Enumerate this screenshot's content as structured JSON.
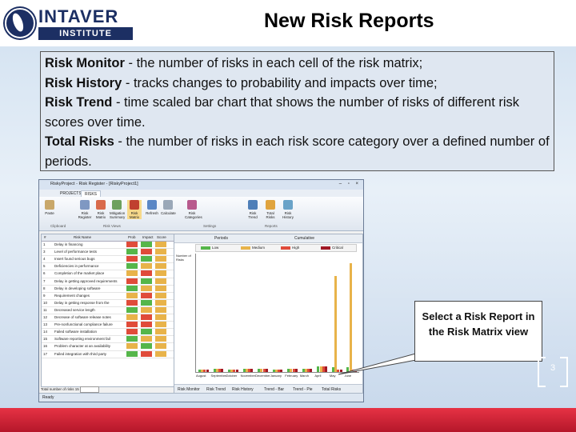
{
  "header": {
    "logo_top": "INTAVER",
    "logo_bottom": "INSTITUTE",
    "title": "New Risk Reports"
  },
  "textbox": {
    "items": [
      {
        "term": "Risk Monitor",
        "desc": " - the number of risks in each cell of the risk matrix;"
      },
      {
        "term": "Risk History",
        "desc": " - tracks changes to probability and impacts over time;"
      },
      {
        "term": "Risk Trend",
        "desc": " - time scaled bar chart that shows the  number of risks of different risk scores over time."
      },
      {
        "term": "Total Risks",
        "desc": " - the number of risks in each risk score category over a defined number of periods."
      }
    ]
  },
  "callout": {
    "text": "Select a Risk Report in the Risk Matrix view"
  },
  "page_number": "3",
  "colors": {
    "bottom_bar": "#d2263a",
    "logo_navy": "#1c2f63",
    "risk_low": "#55b64a",
    "risk_medium": "#e8b34a",
    "risk_high": "#e04b3a"
  },
  "app": {
    "window_title": "RiskyProject - Risk Register - [RiskyProject1]",
    "tabs": [
      "PROJECTS",
      "RISKS"
    ],
    "ribbon": {
      "buttons": [
        "Paste",
        "Risk Register",
        "Risk Matrix",
        "Mitigation Summary",
        "Risk Matrix",
        "Refresh",
        "Calculate",
        "Risk Categories",
        "Risk Trend",
        "Total Risks",
        "Risk History"
      ],
      "groups": [
        "Clipboard",
        "Risk Views",
        "Settings",
        "Reports"
      ]
    },
    "grid": {
      "headers": [
        "#",
        "Risk Name",
        "Prob",
        "Impact",
        "Score"
      ],
      "rows": [
        {
          "num": "1",
          "name": "Delay in financing"
        },
        {
          "num": "3",
          "name": "Level of performance tests"
        },
        {
          "num": "4",
          "name": "Insert found serious bugs"
        },
        {
          "num": "5",
          "name": "Deficiencies in performance"
        },
        {
          "num": "6",
          "name": "Completion of the market place"
        },
        {
          "num": "7",
          "name": "Delay in getting approved requirements"
        },
        {
          "num": "8",
          "name": "Delay in developing software"
        },
        {
          "num": "9",
          "name": "Requirement changes"
        },
        {
          "num": "10",
          "name": "Delay in getting response from the"
        },
        {
          "num": "11",
          "name": "Decreased service length"
        },
        {
          "num": "12",
          "name": "Decrease of software release notes"
        },
        {
          "num": "13",
          "name": "Pre-nonfunctional compliance failure"
        },
        {
          "num": "14",
          "name": "Failed software installation"
        },
        {
          "num": "15",
          "name": "Software reporting environment fail"
        },
        {
          "num": "16",
          "name": "Problem character at an availability"
        },
        {
          "num": "17",
          "name": "Failed integration with third party"
        }
      ],
      "footer": "Total number of risks 15"
    },
    "chart": {
      "tabs": [
        "Periods",
        "Cumulative"
      ],
      "legend": [
        "Low",
        "Medium",
        "High",
        "Critical"
      ],
      "ylabel": "Number of Risks",
      "months": [
        "August",
        "September",
        "October",
        "November",
        "December",
        "January",
        "February",
        "March",
        "April",
        "May",
        "June"
      ],
      "bottom_options": [
        "Risk Monitor",
        "Risk Trend",
        "Risk History",
        "Trend - Bar",
        "Trend - Pie",
        "Total Risks"
      ]
    },
    "status": "Ready"
  }
}
